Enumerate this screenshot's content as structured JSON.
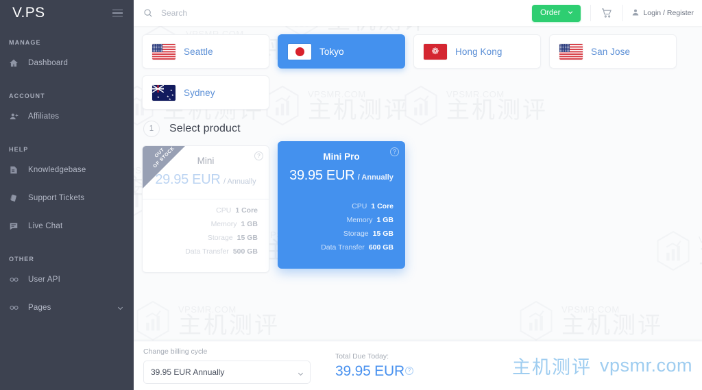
{
  "sidebar": {
    "logo": "V.PS",
    "menu_icon": "hamburger-icon",
    "groups": [
      {
        "label": "MANAGE",
        "items": [
          {
            "label": "Dashboard",
            "icon": "home-icon"
          }
        ]
      },
      {
        "label": "ACCOUNT",
        "items": [
          {
            "label": "Affiliates",
            "icon": "add-user-icon"
          }
        ]
      },
      {
        "label": "HELP",
        "items": [
          {
            "label": "Knowledgebase",
            "icon": "book-icon"
          },
          {
            "label": "Support Tickets",
            "icon": "ticket-icon"
          },
          {
            "label": "Live Chat",
            "icon": "chat-icon"
          }
        ]
      },
      {
        "label": "OTHER",
        "items": [
          {
            "label": "User API",
            "icon": "link-icon"
          },
          {
            "label": "Pages",
            "icon": "link-icon",
            "expandable": true
          }
        ]
      }
    ]
  },
  "topbar": {
    "search_placeholder": "Search",
    "search_value": "",
    "search_icon": "search-icon",
    "order_label": "Order",
    "order_caret": "chevron-down-icon",
    "cart_icon": "shopping-cart-icon",
    "account_icon": "user-icon",
    "account_label": "Login / Register",
    "order_color": "#2ece71"
  },
  "locations": {
    "selected": "Tokyo",
    "items": [
      {
        "name": "Seattle",
        "flag": "us",
        "selected": false
      },
      {
        "name": "Tokyo",
        "flag": "jp",
        "selected": true
      },
      {
        "name": "Hong Kong",
        "flag": "hk",
        "selected": false
      },
      {
        "name": "San Jose",
        "flag": "us",
        "selected": false
      },
      {
        "name": "Sydney",
        "flag": "au",
        "selected": false
      }
    ]
  },
  "step": {
    "number": "1",
    "title": "Select product"
  },
  "products": [
    {
      "name": "Mini",
      "price": "29.95 EUR",
      "cycle": "/ Annually",
      "selected": false,
      "out_of_stock": true,
      "out_of_stock_label": "OUT\nOF STOCK",
      "help_icon": "question-mark-icon",
      "specs": [
        {
          "key": "CPU",
          "value": "1 Core"
        },
        {
          "key": "Memory",
          "value": "1 GB"
        },
        {
          "key": "Storage",
          "value": "15 GB"
        },
        {
          "key": "Data Transfer",
          "value": "500 GB"
        }
      ]
    },
    {
      "name": "Mini Pro",
      "price": "39.95 EUR",
      "cycle": "/ Annually",
      "selected": true,
      "out_of_stock": false,
      "help_icon": "question-mark-icon",
      "specs": [
        {
          "key": "CPU",
          "value": "1 Core"
        },
        {
          "key": "Memory",
          "value": "1 GB"
        },
        {
          "key": "Storage",
          "value": "15 GB"
        },
        {
          "key": "Data Transfer",
          "value": "600 GB"
        }
      ]
    }
  ],
  "footer": {
    "billing_label": "Change billing cycle",
    "billing_value": "39.95 EUR Annually",
    "billing_options": [
      "39.95 EUR Annually"
    ],
    "total_label": "Total Due Today:",
    "total_value": "39.95 EUR",
    "total_help_icon": "question-mark-icon",
    "accent_color": "#4a92ef"
  },
  "watermark": {
    "domain": "VPSMR.COM",
    "cn": "主机测评",
    "brand_cn": "主机测评",
    "brand_en": "vpsmr.com",
    "logo": "hexagon-chart-icon"
  }
}
